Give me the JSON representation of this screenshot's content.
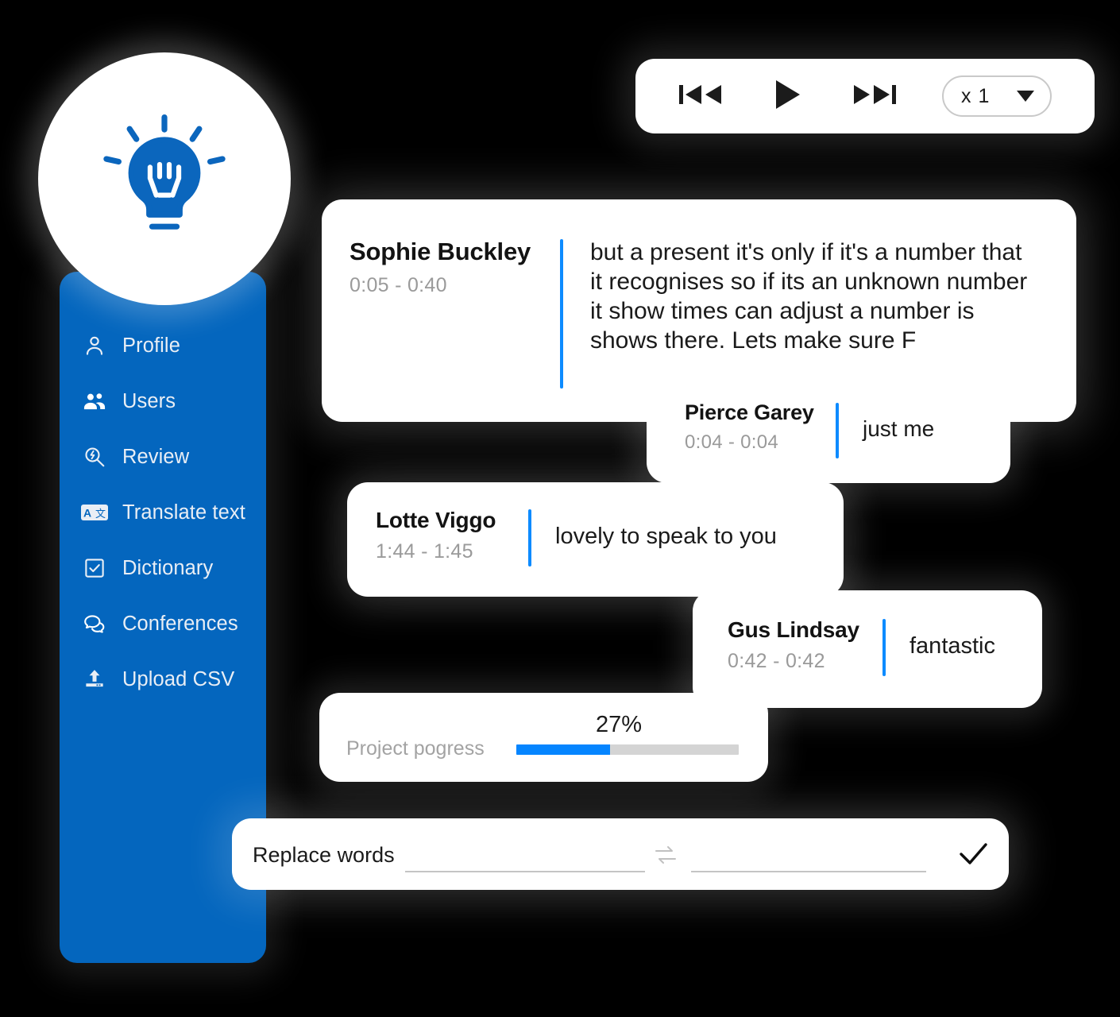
{
  "brand": {
    "logo_icon": "lightbulb-icon",
    "accent_blue": "#0d8bff",
    "sidebar_blue": "#0466be",
    "progress_blue": "#0585ff"
  },
  "sidebar": {
    "items": [
      {
        "label": "Profile",
        "icon": "user-icon"
      },
      {
        "label": "Users",
        "icon": "users-group-icon"
      },
      {
        "label": "Review",
        "icon": "search-bolt-icon"
      },
      {
        "label": "Translate text",
        "icon": "translate-icon"
      },
      {
        "label": "Dictionary",
        "icon": "checkbox-icon"
      },
      {
        "label": "Conferences",
        "icon": "chat-bubbles-icon"
      },
      {
        "label": "Upload CSV",
        "icon": "upload-icon"
      }
    ]
  },
  "player": {
    "prev_icon": "skip-previous-icon",
    "play_icon": "play-icon",
    "next_icon": "skip-next-icon",
    "speed_value": "x 1",
    "speed_caret_icon": "chevron-down-icon",
    "speed_options": [
      "x 1"
    ]
  },
  "transcript": {
    "entries": [
      {
        "speaker": "Sophie Buckley",
        "time": "0:05 - 0:40",
        "text": "but a present it's only if it's a number that it recognises so if its an unknown number it show times can adjust a number is shows there. Lets make sure F"
      },
      {
        "speaker": "Pierce Garey",
        "time": "0:04 - 0:04",
        "text": "just me"
      },
      {
        "speaker": "Lotte Viggo",
        "time": "1:44 - 1:45",
        "text": "lovely to speak to you"
      },
      {
        "speaker": "Gus Lindsay",
        "time": "0:42 - 0:42",
        "text": "fantastic"
      }
    ]
  },
  "progress": {
    "label": "Project pogress",
    "percent_text": "27%",
    "percent_value": 42
  },
  "replace": {
    "label": "Replace words",
    "find_value": "",
    "replace_value": "",
    "swap_icon": "swap-arrows-icon",
    "confirm_icon": "check-icon"
  }
}
